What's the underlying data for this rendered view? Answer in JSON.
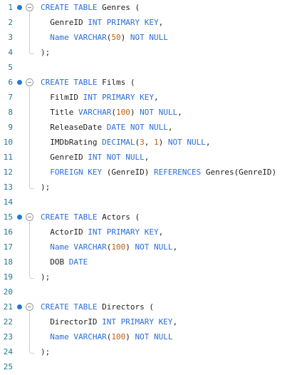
{
  "editor": {
    "language": "SQL",
    "colors": {
      "keyword": "#2b6ed8",
      "number": "#c25d0d",
      "identifier": "#222222",
      "line_number": "#237893",
      "breakpoint": "#1f7ad6"
    },
    "lines": [
      {
        "number": "1",
        "tokens": [
          {
            "t": "kw",
            "v": "CREATE TABLE"
          },
          {
            "t": "id",
            "v": " Genres ("
          }
        ]
      },
      {
        "number": "2",
        "tokens": [
          {
            "t": "id",
            "v": "  GenreID "
          },
          {
            "t": "kw",
            "v": "INT PRIMARY KEY"
          },
          {
            "t": "id",
            "v": ","
          }
        ]
      },
      {
        "number": "3",
        "tokens": [
          {
            "t": "id",
            "v": "  "
          },
          {
            "t": "kw",
            "v": "Name VARCHAR"
          },
          {
            "t": "id",
            "v": "("
          },
          {
            "t": "num",
            "v": "50"
          },
          {
            "t": "id",
            "v": ") "
          },
          {
            "t": "kw",
            "v": "NOT NULL"
          }
        ]
      },
      {
        "number": "4",
        "tokens": [
          {
            "t": "id",
            "v": ");"
          }
        ]
      },
      {
        "number": "5",
        "tokens": []
      },
      {
        "number": "6",
        "tokens": [
          {
            "t": "kw",
            "v": "CREATE TABLE"
          },
          {
            "t": "id",
            "v": " Films ("
          }
        ]
      },
      {
        "number": "7",
        "tokens": [
          {
            "t": "id",
            "v": "  FilmID "
          },
          {
            "t": "kw",
            "v": "INT PRIMARY KEY"
          },
          {
            "t": "id",
            "v": ","
          }
        ]
      },
      {
        "number": "8",
        "tokens": [
          {
            "t": "id",
            "v": "  Title "
          },
          {
            "t": "kw",
            "v": "VARCHAR"
          },
          {
            "t": "id",
            "v": "("
          },
          {
            "t": "num",
            "v": "100"
          },
          {
            "t": "id",
            "v": ") "
          },
          {
            "t": "kw",
            "v": "NOT NULL"
          },
          {
            "t": "id",
            "v": ","
          }
        ]
      },
      {
        "number": "9",
        "tokens": [
          {
            "t": "id",
            "v": "  ReleaseDate "
          },
          {
            "t": "kw",
            "v": "DATE NOT NULL"
          },
          {
            "t": "id",
            "v": ","
          }
        ]
      },
      {
        "number": "10",
        "tokens": [
          {
            "t": "id",
            "v": "  IMDbRating "
          },
          {
            "t": "kw",
            "v": "DECIMAL"
          },
          {
            "t": "id",
            "v": "("
          },
          {
            "t": "num",
            "v": "3"
          },
          {
            "t": "id",
            "v": ", "
          },
          {
            "t": "num",
            "v": "1"
          },
          {
            "t": "id",
            "v": ") "
          },
          {
            "t": "kw",
            "v": "NOT NULL"
          },
          {
            "t": "id",
            "v": ","
          }
        ]
      },
      {
        "number": "11",
        "tokens": [
          {
            "t": "id",
            "v": "  GenreID "
          },
          {
            "t": "kw",
            "v": "INT NOT NULL"
          },
          {
            "t": "id",
            "v": ","
          }
        ]
      },
      {
        "number": "12",
        "tokens": [
          {
            "t": "id",
            "v": "  "
          },
          {
            "t": "kw",
            "v": "FOREIGN KEY"
          },
          {
            "t": "id",
            "v": " (GenreID) "
          },
          {
            "t": "kw",
            "v": "REFERENCES"
          },
          {
            "t": "id",
            "v": " Genres(GenreID)"
          }
        ]
      },
      {
        "number": "13",
        "tokens": [
          {
            "t": "id",
            "v": ");"
          }
        ]
      },
      {
        "number": "14",
        "tokens": []
      },
      {
        "number": "15",
        "tokens": [
          {
            "t": "kw",
            "v": "CREATE TABLE"
          },
          {
            "t": "id",
            "v": " Actors ("
          }
        ]
      },
      {
        "number": "16",
        "tokens": [
          {
            "t": "id",
            "v": "  ActorID "
          },
          {
            "t": "kw",
            "v": "INT PRIMARY KEY"
          },
          {
            "t": "id",
            "v": ","
          }
        ]
      },
      {
        "number": "17",
        "tokens": [
          {
            "t": "id",
            "v": "  "
          },
          {
            "t": "kw",
            "v": "Name VARCHAR"
          },
          {
            "t": "id",
            "v": "("
          },
          {
            "t": "num",
            "v": "100"
          },
          {
            "t": "id",
            "v": ") "
          },
          {
            "t": "kw",
            "v": "NOT NULL"
          },
          {
            "t": "id",
            "v": ","
          }
        ]
      },
      {
        "number": "18",
        "tokens": [
          {
            "t": "id",
            "v": "  DOB "
          },
          {
            "t": "kw",
            "v": "DATE"
          }
        ]
      },
      {
        "number": "19",
        "tokens": [
          {
            "t": "id",
            "v": ");"
          }
        ]
      },
      {
        "number": "20",
        "tokens": []
      },
      {
        "number": "21",
        "tokens": [
          {
            "t": "kw",
            "v": "CREATE TABLE"
          },
          {
            "t": "id",
            "v": " Directors ("
          }
        ]
      },
      {
        "number": "22",
        "tokens": [
          {
            "t": "id",
            "v": "  DirectorID "
          },
          {
            "t": "kw",
            "v": "INT PRIMARY KEY"
          },
          {
            "t": "id",
            "v": ","
          }
        ]
      },
      {
        "number": "23",
        "tokens": [
          {
            "t": "id",
            "v": "  "
          },
          {
            "t": "kw",
            "v": "Name VARCHAR"
          },
          {
            "t": "id",
            "v": "("
          },
          {
            "t": "num",
            "v": "100"
          },
          {
            "t": "id",
            "v": ") "
          },
          {
            "t": "kw",
            "v": "NOT NULL"
          }
        ]
      },
      {
        "number": "24",
        "tokens": [
          {
            "t": "id",
            "v": ");"
          }
        ]
      },
      {
        "number": "25",
        "tokens": []
      }
    ],
    "foldable_lines": [
      "1",
      "6",
      "15",
      "21"
    ],
    "breakpoint_lines": [
      "1",
      "6",
      "15",
      "21"
    ],
    "fold_icon": "collapse-circle-icon",
    "breakpoint_icon": "breakpoint-dot-icon"
  }
}
